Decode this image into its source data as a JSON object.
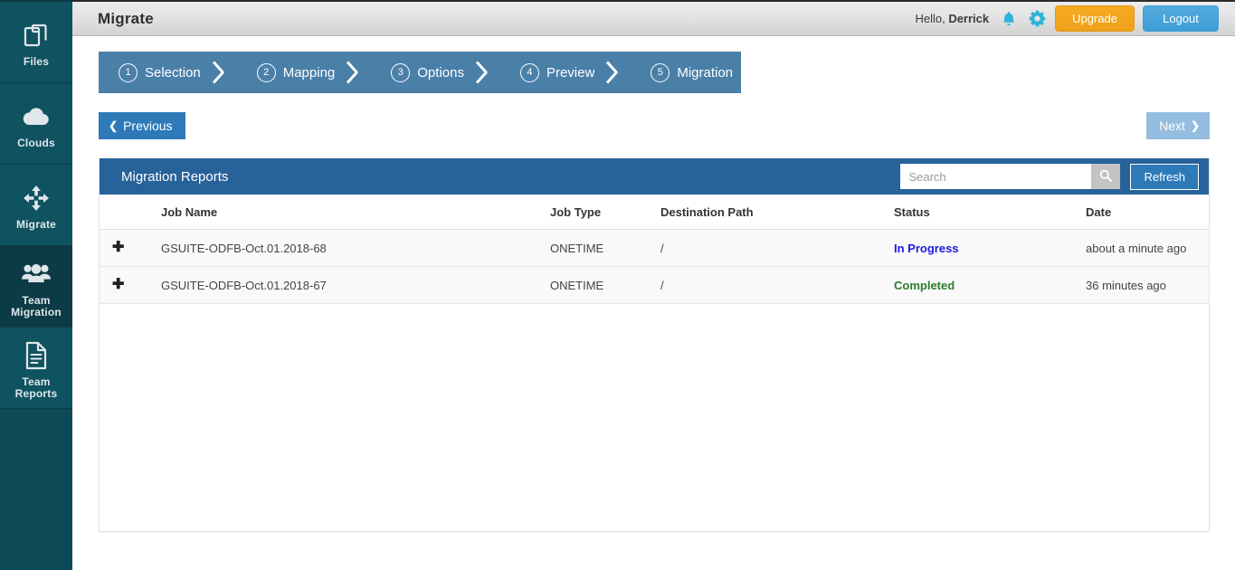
{
  "sidebar": {
    "items": [
      {
        "label": "Files",
        "icon": "files-icon",
        "active": false
      },
      {
        "label": "Clouds",
        "icon": "cloud-icon",
        "active": false
      },
      {
        "label": "Migrate",
        "icon": "move-arrows-icon",
        "active": false
      },
      {
        "label": "Team Migration",
        "icon": "people-group-icon",
        "active": true
      },
      {
        "label": "Team Reports",
        "icon": "document-report-icon",
        "active": false
      }
    ]
  },
  "topbar": {
    "title": "Migrate",
    "greeting_prefix": "Hello, ",
    "user_name": "Derrick",
    "bell_icon": "bell-icon",
    "gear_icon": "gear-icon",
    "upgrade_label": "Upgrade",
    "logout_label": "Logout",
    "upgrade_color": "#f2a41c",
    "logout_color": "#45a1d8"
  },
  "wizard": {
    "steps": [
      {
        "num": "1",
        "label": "Selection"
      },
      {
        "num": "2",
        "label": "Mapping"
      },
      {
        "num": "3",
        "label": "Options"
      },
      {
        "num": "4",
        "label": "Preview"
      },
      {
        "num": "5",
        "label": "Migration"
      }
    ],
    "bar_color": "#4a7fa8"
  },
  "nav": {
    "previous_label": "Previous",
    "previous_chevron": "❮",
    "next_label": "Next",
    "next_chevron": "❯",
    "previous_color": "#2e7ab8",
    "next_color": "#94bde0"
  },
  "panel": {
    "title": "Migration Reports",
    "header_color": "#28629a",
    "search": {
      "placeholder": "Search",
      "value": "",
      "icon": "search-icon"
    },
    "refresh_label": "Refresh"
  },
  "table": {
    "columns": [
      "",
      "Job Name",
      "Job Type",
      "Destination Path",
      "Status",
      "Date"
    ],
    "expand_glyph": "✚",
    "rows": [
      {
        "name": "GSUITE-ODFB-Oct.01.2018-68",
        "type": "ONETIME",
        "path": "/",
        "status": "In Progress",
        "status_color": "#1a1ae0",
        "date": "about a minute ago"
      },
      {
        "name": "GSUITE-ODFB-Oct.01.2018-67",
        "type": "ONETIME",
        "path": "/",
        "status": "Completed",
        "status_color": "#2a7d2a",
        "date": "36 minutes ago"
      }
    ]
  }
}
